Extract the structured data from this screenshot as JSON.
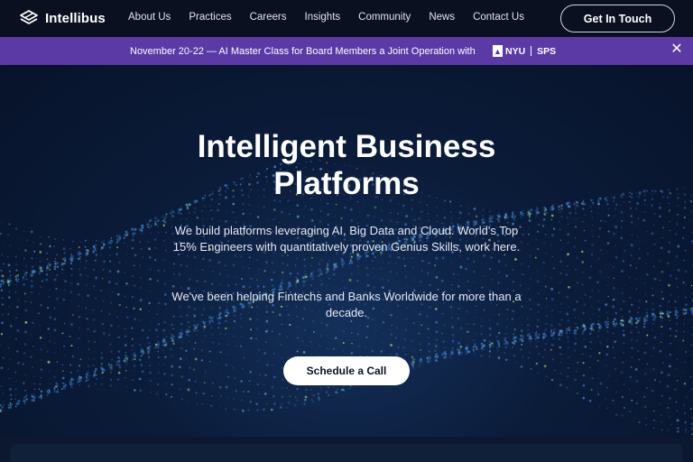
{
  "brand": {
    "name": "Intellibus"
  },
  "nav": {
    "items": [
      "About Us",
      "Practices",
      "Careers",
      "Insights",
      "Community",
      "News",
      "Contact Us"
    ],
    "cta": "Get In Touch"
  },
  "banner": {
    "text": "November 20-22 — AI Master Class for Board Members a Joint Operation with",
    "partner_left": "NYU",
    "partner_right": "SPS",
    "close_icon": "close-icon"
  },
  "hero": {
    "title_line1": "Intelligent Business",
    "title_line2": "Platforms",
    "paragraph1": "We build platforms leveraging AI, Big Data and Cloud. World's Top 15% Engineers with quantitatively proven Genius Skills, work here.",
    "paragraph2": "We've been helping Fintechs and Banks Worldwide for more than a decade.",
    "cta": "Schedule a Call"
  },
  "colors": {
    "nav_bg": "#0b1020",
    "banner_bg": "#5b3aa6",
    "hero_bg": "#0b1c3a",
    "button_bg": "#ffffff"
  }
}
